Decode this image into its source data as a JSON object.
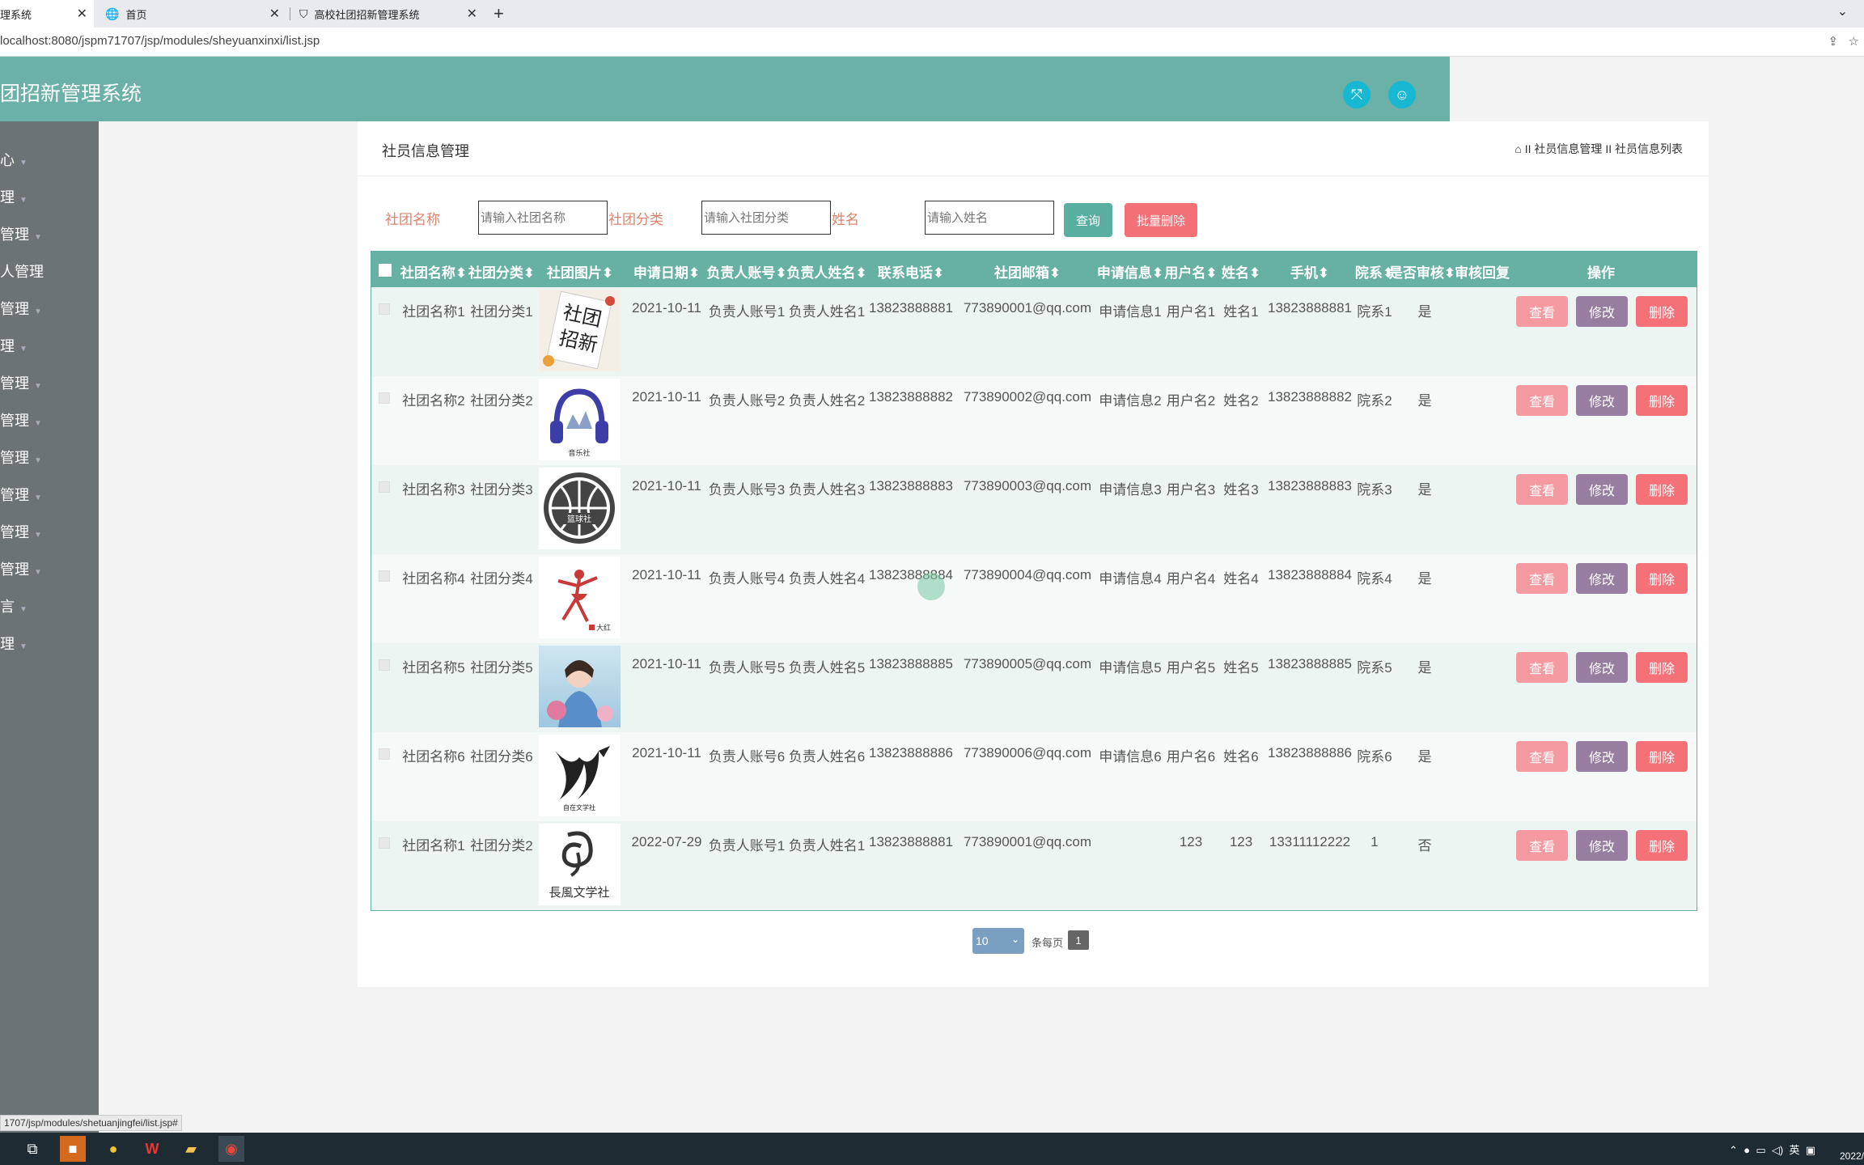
{
  "browser": {
    "tabs": [
      {
        "label": "理系统",
        "active": true
      },
      {
        "label": "首页",
        "active": false
      },
      {
        "label": "高校社团招新管理系统",
        "active": false
      }
    ],
    "new_tab": "+",
    "address": "localhost:8080/jspm71707/jsp/modules/sheyuanxinxi/list.jsp",
    "status_url": "1707/jsp/modules/shetuanjingfei/list.jsp#"
  },
  "header": {
    "title": "团招新管理系统"
  },
  "sidebar": {
    "items": [
      "心",
      "理",
      "管理",
      "人管理",
      "管理",
      "理",
      "管理",
      "管理",
      "管理",
      "管理",
      "管理",
      "管理",
      "言",
      "理"
    ]
  },
  "panel": {
    "title": "社员信息管理",
    "breadcrumb": "II 社员信息管理 II 社员信息列表"
  },
  "filters": {
    "club_name_label": "社团名称",
    "club_name_placeholder": "请输入社团名称",
    "club_type_label": "社团分类",
    "club_type_placeholder": "请输入社团分类",
    "name_label": "姓名",
    "name_placeholder": "请输入姓名",
    "query_button": "查询",
    "batch_delete_button": "批量删除"
  },
  "table": {
    "columns": [
      "社团名称",
      "社团分类",
      "社团图片",
      "申请日期",
      "负责人账号",
      "负责人姓名",
      "联系电话",
      "社团邮箱",
      "申请信息",
      "用户名",
      "姓名",
      "手机",
      "院系",
      "是否审核",
      "审核回复",
      "操作"
    ],
    "sort_arrow": "⬍",
    "rows": [
      {
        "club_name": "社团名称1",
        "club_type": "社团分类1",
        "image": "club-recruit-poster",
        "date": "2021-10-11",
        "leader_account": "负责人账号1",
        "leader_name": "负责人姓名1",
        "phone": "13823888881",
        "email": "773890001@qq.com",
        "apply_info": "申请信息1",
        "username": "用户名1",
        "name": "姓名1",
        "mobile": "13823888881",
        "dept": "院系1",
        "approved": "是",
        "reply": ""
      },
      {
        "club_name": "社团名称2",
        "club_type": "社团分类2",
        "image": "music-headphones-logo",
        "date": "2021-10-11",
        "leader_account": "负责人账号2",
        "leader_name": "负责人姓名2",
        "phone": "13823888882",
        "email": "773890002@qq.com",
        "apply_info": "申请信息2",
        "username": "用户名2",
        "name": "姓名2",
        "mobile": "13823888882",
        "dept": "院系2",
        "approved": "是",
        "reply": ""
      },
      {
        "club_name": "社团名称3",
        "club_type": "社团分类3",
        "image": "basketball-club-logo",
        "date": "2021-10-11",
        "leader_account": "负责人账号3",
        "leader_name": "负责人姓名3",
        "phone": "13823888883",
        "email": "773890003@qq.com",
        "apply_info": "申请信息3",
        "username": "用户名3",
        "name": "姓名3",
        "mobile": "13823888883",
        "dept": "院系3",
        "approved": "是",
        "reply": ""
      },
      {
        "club_name": "社团名称4",
        "club_type": "社团分类4",
        "image": "dance-figure-logo",
        "date": "2021-10-11",
        "leader_account": "负责人账号4",
        "leader_name": "负责人姓名4",
        "phone": "13823888884",
        "email": "773890004@qq.com",
        "apply_info": "申请信息4",
        "username": "用户名4",
        "name": "姓名4",
        "mobile": "13823888884",
        "dept": "院系4",
        "approved": "是",
        "reply": ""
      },
      {
        "club_name": "社团名称5",
        "club_type": "社团分类5",
        "image": "girl-photo",
        "date": "2021-10-11",
        "leader_account": "负责人账号5",
        "leader_name": "负责人姓名5",
        "phone": "13823888885",
        "email": "773890005@qq.com",
        "apply_info": "申请信息5",
        "username": "用户名5",
        "name": "姓名5",
        "mobile": "13823888885",
        "dept": "院系5",
        "approved": "是",
        "reply": ""
      },
      {
        "club_name": "社团名称6",
        "club_type": "社团分类6",
        "image": "literature-club-logo",
        "date": "2021-10-11",
        "leader_account": "负责人账号6",
        "leader_name": "负责人姓名6",
        "phone": "13823888886",
        "email": "773890006@qq.com",
        "apply_info": "申请信息6",
        "username": "用户名6",
        "name": "姓名6",
        "mobile": "13823888886",
        "dept": "院系6",
        "approved": "是",
        "reply": ""
      },
      {
        "club_name": "社团名称1",
        "club_type": "社团分类2",
        "image": "changfeng-literature-logo",
        "date": "2022-07-29",
        "leader_account": "负责人账号1",
        "leader_name": "负责人姓名1",
        "phone": "13823888881",
        "email": "773890001@qq.com",
        "apply_info": "",
        "username": "123",
        "name": "123",
        "mobile": "13311112222",
        "dept": "1",
        "approved": "否",
        "reply": ""
      }
    ],
    "actions": {
      "view": "查看",
      "edit": "修改",
      "delete": "删除"
    }
  },
  "pagination": {
    "page_size": "10",
    "per_page_label": "条每页",
    "current_page": "1"
  },
  "taskbar": {
    "tray_lang": "英",
    "clock": "2022/"
  }
}
